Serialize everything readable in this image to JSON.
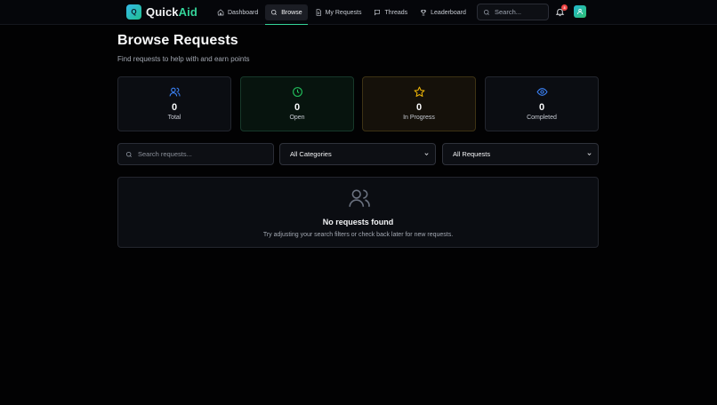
{
  "app": {
    "logo_letter": "Q",
    "name_part1": "Quick",
    "name_part2": "Aid"
  },
  "nav": {
    "items": [
      {
        "label": "Dashboard",
        "icon": "home-icon",
        "active": false
      },
      {
        "label": "Browse",
        "icon": "search-icon",
        "active": true
      },
      {
        "label": "My Requests",
        "icon": "document-icon",
        "active": false
      },
      {
        "label": "Threads",
        "icon": "chat-icon",
        "active": false
      },
      {
        "label": "Leaderboard",
        "icon": "trophy-icon",
        "active": false
      }
    ]
  },
  "header": {
    "search_placeholder": "Search...",
    "notification_count": "3",
    "avatar_icon": "user-icon"
  },
  "page": {
    "title": "Browse Requests",
    "subtitle": "Find requests to help with and earn points"
  },
  "stats": [
    {
      "label": "Total",
      "value": "0",
      "icon": "users-icon",
      "color": "#3b82f6"
    },
    {
      "label": "Open",
      "value": "0",
      "icon": "clock-icon",
      "color": "#22c55e"
    },
    {
      "label": "In Progress",
      "value": "0",
      "icon": "star-icon",
      "color": "#eab308"
    },
    {
      "label": "Completed",
      "value": "0",
      "icon": "eye-icon",
      "color": "#3b82f6"
    }
  ],
  "filters": {
    "search_placeholder": "Search requests...",
    "category_selected": "All Categories",
    "status_selected": "All Requests"
  },
  "empty_state": {
    "icon": "users-icon",
    "title": "No requests found",
    "description": "Try adjusting your search filters or check back later for new requests."
  },
  "colors": {
    "accent": "#34d399",
    "background": "#020203",
    "card": "#0b0d12"
  }
}
